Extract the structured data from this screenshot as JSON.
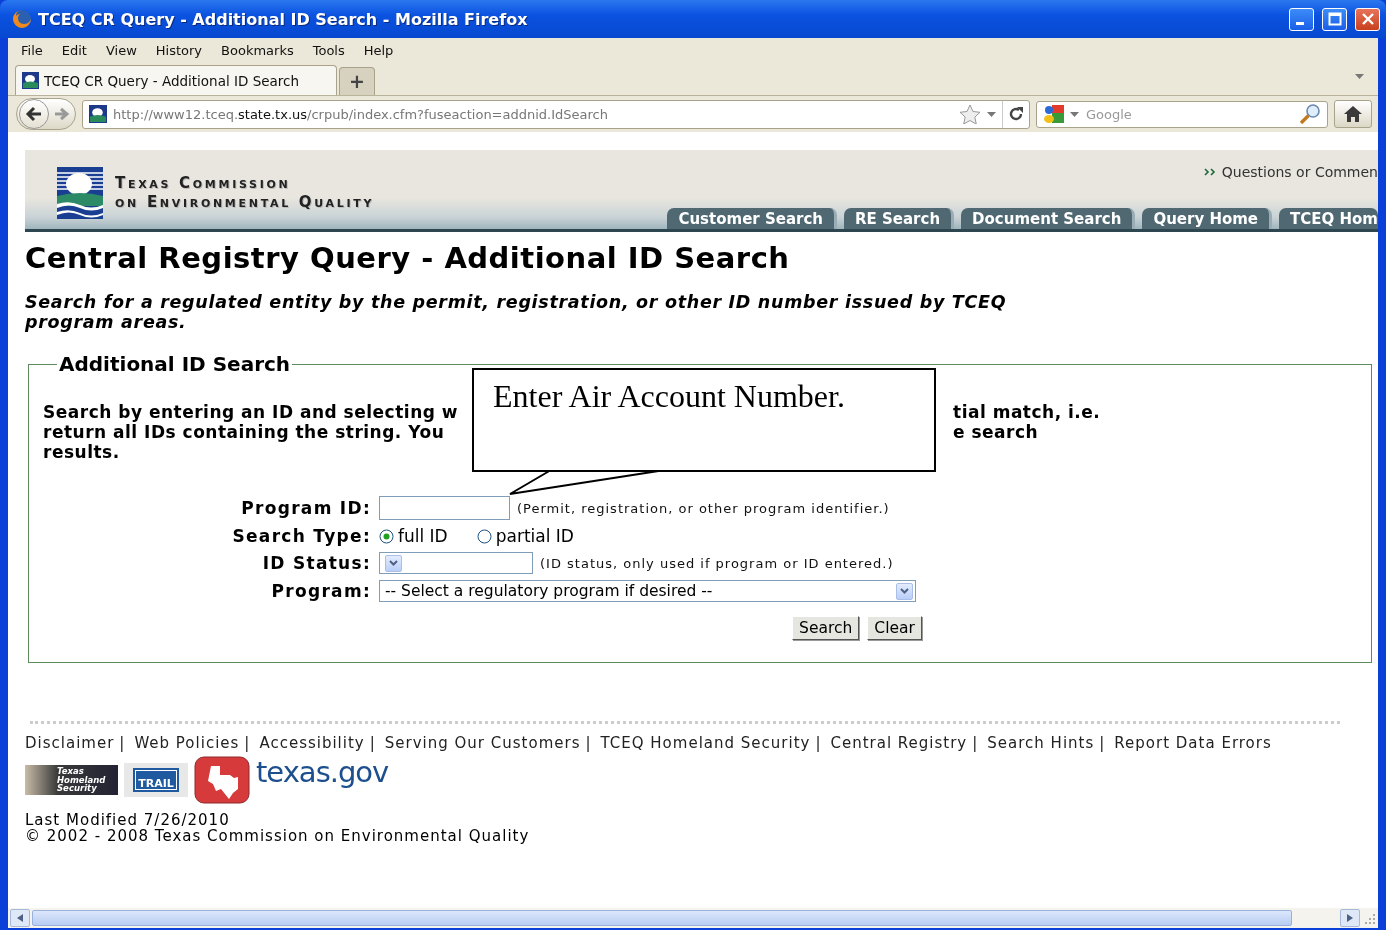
{
  "window": {
    "title": "TCEQ CR Query - Additional ID Search - Mozilla Firefox"
  },
  "menu": [
    "File",
    "Edit",
    "View",
    "History",
    "Bookmarks",
    "Tools",
    "Help"
  ],
  "tabs": [
    {
      "label": "TCEQ CR Query - Additional ID Search",
      "selected": true
    }
  ],
  "new_tab": "+",
  "address_bar": {
    "url_prefix": "http://www12.tceq.",
    "url_domain": "state.tx.us",
    "url_path": "/crpub/index.cfm?fuseaction=addnid.IdSearch"
  },
  "search_box": {
    "placeholder": "Google"
  },
  "site_header": {
    "org_line_1": "Texas Commission",
    "org_line_2": "on Environmental Quality",
    "feedback_link": "Questions or Commen",
    "nav_tabs": [
      "Customer Search",
      "RE Search",
      "Document Search",
      "Query Home",
      "TCEQ Hom"
    ]
  },
  "page": {
    "heading": "Central Registry Query - Additional ID Search",
    "intro": "Search for a regulated entity by the permit, registration, or other ID number issued by TCEQ program areas.",
    "fieldset_legend": "Additional ID Search",
    "description_left": [
      "Search by entering an ID and selecting w",
      "return all IDs containing the string. You",
      "results."
    ],
    "description_right": [
      "tial match, i.e.",
      "e search"
    ],
    "callout": "Enter Air Account Number.",
    "form": {
      "program_id": {
        "label": "Program ID:",
        "hint": "(Permit, registration, or other program identifier.)"
      },
      "search_type": {
        "label": "Search Type:",
        "options": [
          {
            "label": "full ID",
            "selected": true
          },
          {
            "label": "partial ID",
            "selected": false
          }
        ]
      },
      "id_status": {
        "label": "ID Status:",
        "hint": "(ID status, only used if program or ID entered.)"
      },
      "program": {
        "label": "Program:",
        "value": "-- Select a regulatory program if desired --"
      },
      "buttons": [
        "Search",
        "Clear"
      ]
    }
  },
  "footer": {
    "links": [
      {
        "label": "Disclaimer",
        "separator": "|"
      },
      {
        "label": "Web Policies",
        "separator": "|"
      },
      {
        "label": "Accessibility",
        "separator": "|"
      },
      {
        "label": "Serving Our Customers",
        "separator": "|"
      },
      {
        "label": "TCEQ Homeland Security",
        "separator": "|"
      },
      {
        "label": "Central Registry",
        "separator": "|"
      },
      {
        "label": "Search Hints",
        "separator": "|"
      },
      {
        "label": "Report Data Errors"
      }
    ],
    "logos": {
      "homeland": "Texas Homeland Security",
      "trail": "TRAIL",
      "texas_gov": "texas.gov"
    },
    "last_modified": "Last Modified 7/26/2010",
    "copyright": "© 2002 - 2008 Texas Commission on Environmental Quality"
  }
}
